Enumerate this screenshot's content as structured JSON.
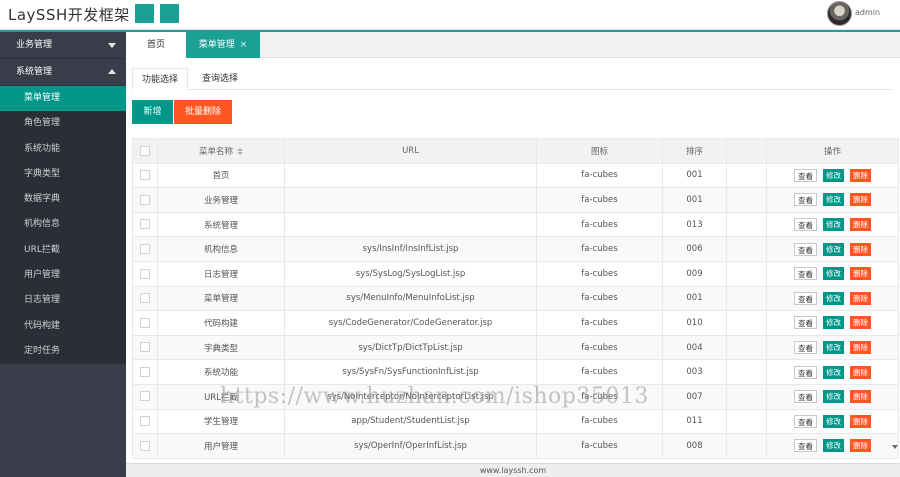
{
  "header": {
    "app_title": "LaySSH开发框架",
    "username": "admin"
  },
  "sidebar": {
    "groups": [
      {
        "label": "业务管理",
        "expanded": false
      },
      {
        "label": "系统管理",
        "expanded": true
      }
    ],
    "items": [
      {
        "label": "菜单管理",
        "active": true
      },
      {
        "label": "角色管理"
      },
      {
        "label": "系统功能"
      },
      {
        "label": "字典类型"
      },
      {
        "label": "数据字典"
      },
      {
        "label": "机构信息"
      },
      {
        "label": "URL拦截"
      },
      {
        "label": "用户管理"
      },
      {
        "label": "日志管理"
      },
      {
        "label": "代码构建"
      },
      {
        "label": "定时任务"
      }
    ]
  },
  "tabs": {
    "home": "首页",
    "current": "菜单管理",
    "close_glyph": "×"
  },
  "subtabs": [
    "功能选择",
    "查询选择"
  ],
  "toolbar": {
    "add_label": "新增",
    "batch_delete_label": "批量删除"
  },
  "table": {
    "headers": {
      "name": "菜单名称",
      "url": "URL",
      "icon": "图标",
      "order": "排序",
      "blank": "",
      "actions": "操作"
    },
    "action_labels": {
      "view": "查看",
      "edit": "修改",
      "delete": "删除"
    },
    "rows": [
      {
        "name": "首页",
        "url": "",
        "icon": "fa-cubes",
        "order": "001"
      },
      {
        "name": "业务管理",
        "url": "",
        "icon": "fa-cubes",
        "order": "001"
      },
      {
        "name": "系统管理",
        "url": "",
        "icon": "fa-cubes",
        "order": "013"
      },
      {
        "name": "机构信息",
        "url": "sys/InsInf/InsInfList.jsp",
        "icon": "fa-cubes",
        "order": "006"
      },
      {
        "name": "日志管理",
        "url": "sys/SysLog/SysLogList.jsp",
        "icon": "fa-cubes",
        "order": "009"
      },
      {
        "name": "菜单管理",
        "url": "sys/MenuInfo/MenuInfoList.jsp",
        "icon": "fa-cubes",
        "order": "001"
      },
      {
        "name": "代码构建",
        "url": "sys/CodeGenerator/CodeGenerator.jsp",
        "icon": "fa-cubes",
        "order": "010"
      },
      {
        "name": "字典类型",
        "url": "sys/DictTp/DictTpList.jsp",
        "icon": "fa-cubes",
        "order": "004"
      },
      {
        "name": "系统功能",
        "url": "sys/SysFn/SysFunctionInfList.jsp",
        "icon": "fa-cubes",
        "order": "003"
      },
      {
        "name": "URL拦截",
        "url": "sys/NoInterceptor/NoInterceptorList.jsp",
        "icon": "fa-cubes",
        "order": "007"
      },
      {
        "name": "学生管理",
        "url": "app/Student/StudentList.jsp",
        "icon": "fa-cubes",
        "order": "011"
      },
      {
        "name": "用户管理",
        "url": "sys/OperInf/OperInfList.jsp",
        "icon": "fa-cubes",
        "order": "008"
      }
    ]
  },
  "footer": {
    "text": "www.layssh.com"
  },
  "watermark": {
    "text": "https://www.huzhan.com/ishop35013"
  },
  "colors": {
    "teal": "#009688",
    "orange": "#ff5722",
    "sidebar": "#393d49"
  }
}
